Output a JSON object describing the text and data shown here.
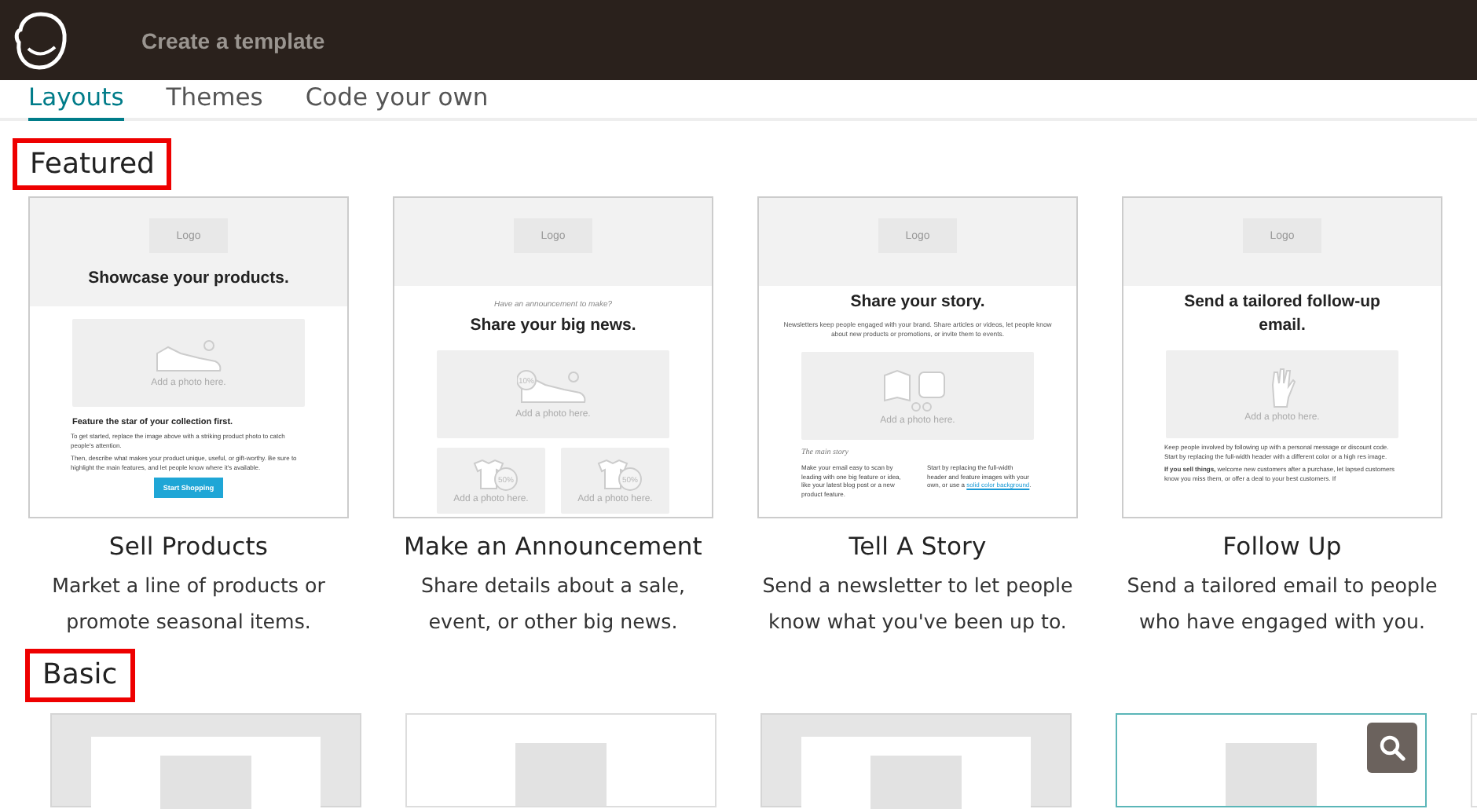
{
  "header": {
    "title": "Create a template"
  },
  "tabs": [
    {
      "label": "Layouts",
      "selected": true
    },
    {
      "label": "Themes",
      "selected": false
    },
    {
      "label": "Code your own",
      "selected": false
    }
  ],
  "featured": {
    "heading": "Featured",
    "highlighted": true,
    "templates": [
      {
        "name": "Sell Products",
        "description": "Market a line of products or promote seasonal items.",
        "preview": [
          {
            "kind": "band",
            "logo": "Logo",
            "title": "Showcase your products."
          },
          {
            "kind": "photo",
            "label": "Add a photo here."
          },
          {
            "kind": "heading",
            "text": "Feature the star of your collection first."
          },
          {
            "kind": "paragraph",
            "text": "To get started, replace the image above with a striking product photo to catch people's attention."
          },
          {
            "kind": "paragraph",
            "text": "Then, describe what makes your product unique, useful, or gift-worthy. Be sure to highlight the main features, and let people know where it's available."
          },
          {
            "kind": "button",
            "text": "Start Shopping"
          }
        ]
      },
      {
        "name": "Make an Announcement",
        "description": "Share details about a sale, event, or other big news.",
        "preview": [
          {
            "kind": "band",
            "logo": "Logo"
          },
          {
            "kind": "kicker",
            "text": "Have an announcement to make?"
          },
          {
            "kind": "title",
            "text": "Share your big news."
          },
          {
            "kind": "photo",
            "tag": "10%",
            "label": "Add a photo here."
          },
          {
            "kind": "photo-pair",
            "tags": [
              "50%",
              "50%"
            ],
            "labels": [
              "Add a photo here.",
              "Add a photo here."
            ]
          }
        ]
      },
      {
        "name": "Tell A Story",
        "description": "Send a newsletter to let people know what you've been up to.",
        "preview": [
          {
            "kind": "band",
            "logo": "Logo"
          },
          {
            "kind": "title",
            "text": "Share your story."
          },
          {
            "kind": "intro",
            "text": "Newsletters keep people engaged with your brand. Share articles or videos, let people know about new products or promotions, or invite them to events."
          },
          {
            "kind": "photo",
            "label": "Add a photo here."
          },
          {
            "kind": "label",
            "text": "The main story"
          },
          {
            "kind": "columns",
            "left": "Make your email easy to scan by leading with one big feature or idea, like your latest blog post or a new product feature.",
            "right": "Start by replacing the full-width header and feature images with your own, or use a ",
            "link": "solid color background",
            "after": "."
          }
        ]
      },
      {
        "name": "Follow Up",
        "description": "Send a tailored email to people who have engaged with you.",
        "preview": [
          {
            "kind": "band",
            "logo": "Logo"
          },
          {
            "kind": "title",
            "text": "Send a tailored follow-up email."
          },
          {
            "kind": "photo",
            "label": "Add a photo here."
          },
          {
            "kind": "paragraph",
            "text": "Keep people involved by following up with a personal message or discount code. Start by replacing the full-width header with a different color or a high res image."
          },
          {
            "kind": "paragraph",
            "text": "**If you sell things,** welcome new customers after a purchase, let lapsed customers know you miss them, or offer a deal to your best customers. If"
          }
        ]
      }
    ]
  },
  "basic": {
    "heading": "Basic",
    "highlighted": true,
    "templates": [
      {
        "kind": "boxed",
        "hovered": false
      },
      {
        "kind": "plain",
        "hovered": false
      },
      {
        "kind": "boxed",
        "hovered": false
      },
      {
        "kind": "plain",
        "hovered": true
      },
      {
        "kind": "plain",
        "hovered": false
      }
    ]
  }
}
